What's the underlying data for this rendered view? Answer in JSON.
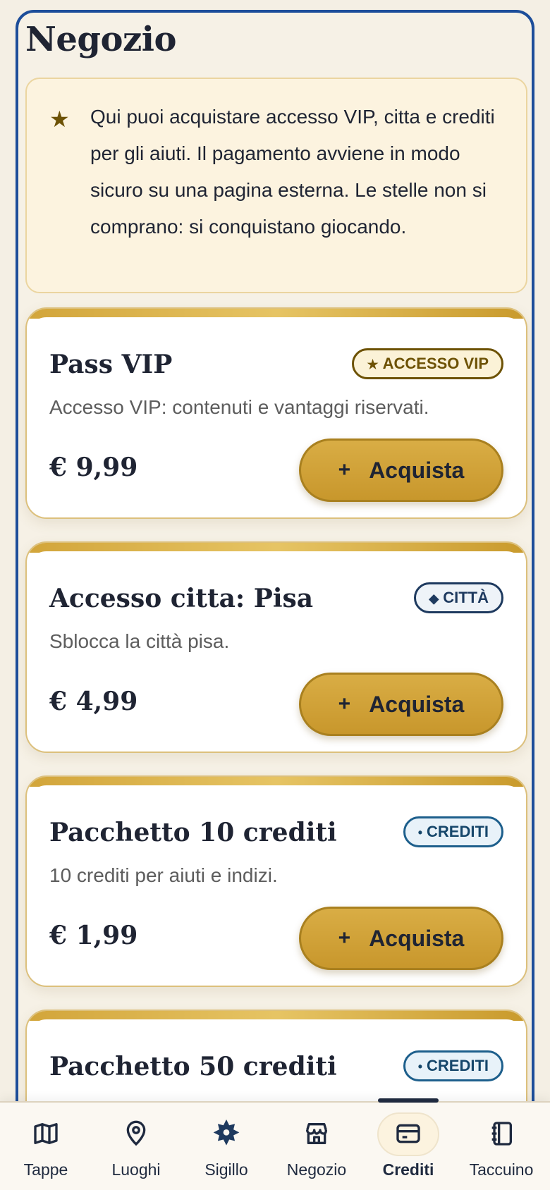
{
  "page": {
    "title": "Negozio"
  },
  "notice": {
    "text": "Qui puoi acquistare accesso VIP, citta e crediti per gli aiuti. Il pagamento avviene in modo sicuro su una pagina esterna. Le stelle non si comprano: si conquistano giocando.",
    "icon": "star-icon"
  },
  "products": [
    {
      "title": "Pass VIP",
      "badge": "ACCESSO VIP",
      "badge_glyph": "★",
      "desc": "Accesso VIP: contenuti e vantaggi riservati.",
      "price": "€ 9,99",
      "buy_label": "Acquista"
    },
    {
      "title": "Accesso citta: Pisa",
      "badge": "CITTÀ",
      "badge_glyph": "◆",
      "desc": "Sblocca la città pisa.",
      "price": "€ 4,99",
      "buy_label": "Acquista"
    },
    {
      "title": "Pacchetto 10 crediti",
      "badge": "CREDITI",
      "badge_glyph": "•",
      "desc": "10 crediti per aiuti e indizi.",
      "price": "€ 1,99",
      "buy_label": "Acquista"
    },
    {
      "title": "Pacchetto 50 crediti",
      "badge": "CREDITI",
      "badge_glyph": "•"
    }
  ],
  "buy_plus": "+",
  "nav": [
    {
      "label": "Tappe",
      "icon": "map-icon"
    },
    {
      "label": "Luoghi",
      "icon": "location-pin-icon"
    },
    {
      "label": "Sigillo",
      "icon": "seal-icon"
    },
    {
      "label": "Negozio",
      "icon": "store-icon"
    },
    {
      "label": "Crediti",
      "icon": "credit-card-icon",
      "active": true
    },
    {
      "label": "Taccuino",
      "icon": "notebook-icon"
    }
  ],
  "colors": {
    "frame_border": "#1d4e9a",
    "gold": "#c8972c",
    "notice_bg": "#fcf3df",
    "text_dark": "#1f2433"
  }
}
